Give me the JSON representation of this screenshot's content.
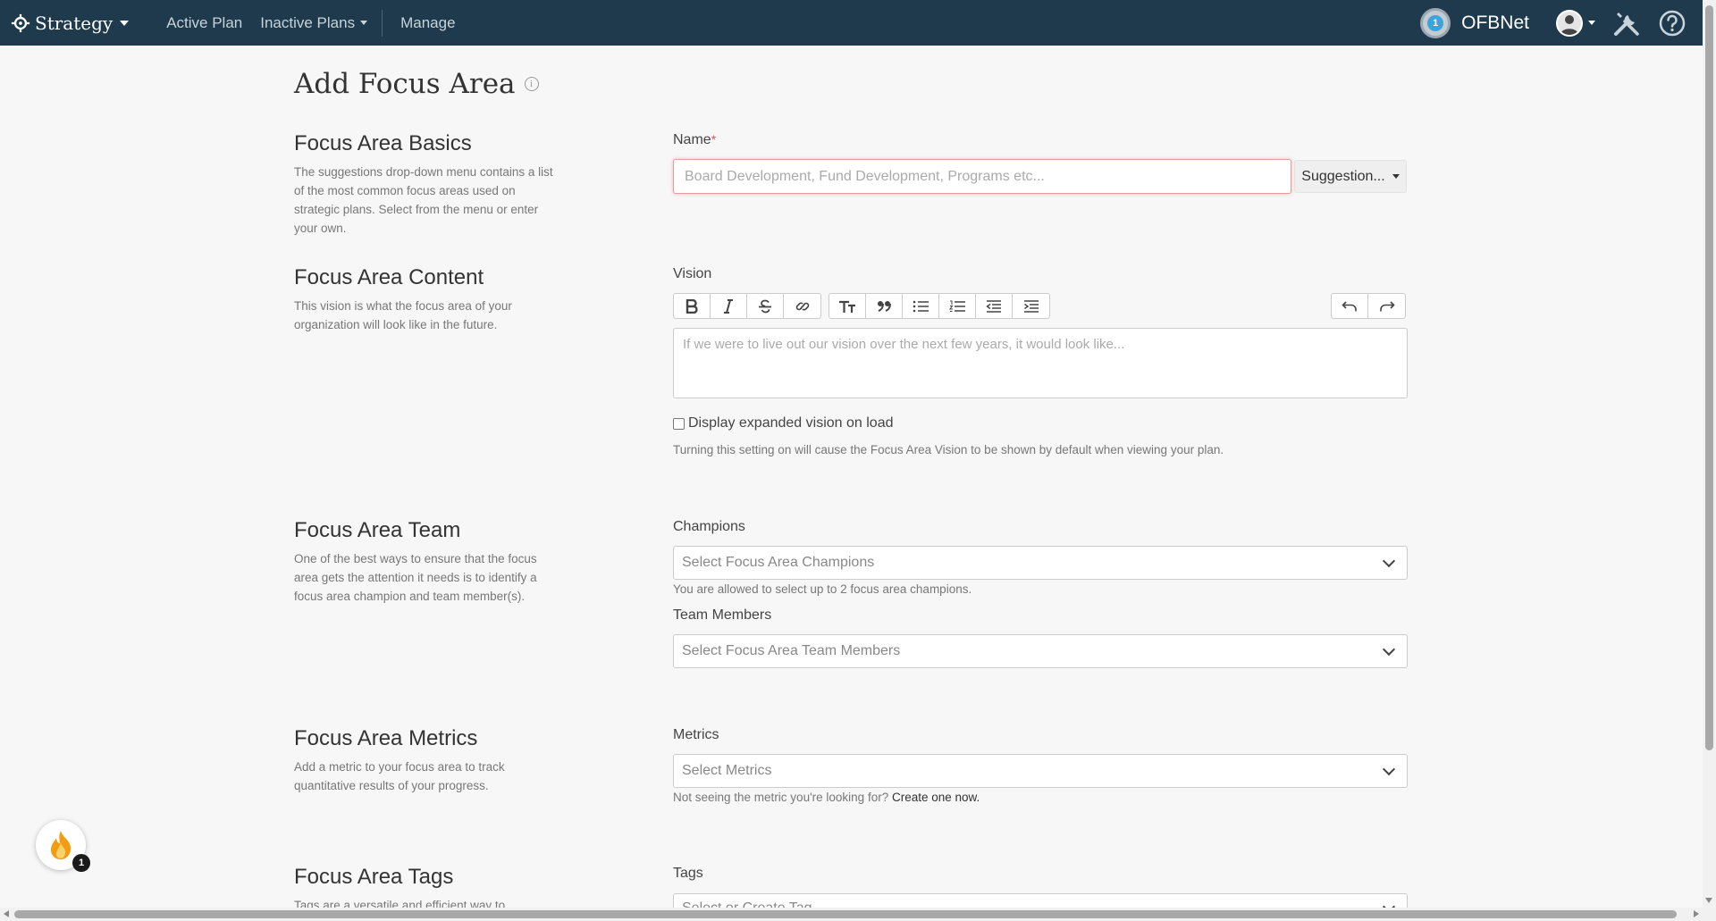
{
  "nav": {
    "brand": "Strategy",
    "links": [
      "Active Plan",
      "Inactive Plans",
      "Manage"
    ],
    "org_name": "OFBNet",
    "org_badge": "1"
  },
  "page": {
    "title": "Add Focus Area"
  },
  "sections": {
    "basics": {
      "title": "Focus Area Basics",
      "desc": "The suggestions drop-down menu contains a list of the most common focus areas used on strategic plans. Select from the menu or enter your own."
    },
    "content": {
      "title": "Focus Area Content",
      "desc": "This vision is what the focus area of your organization will look like in the future."
    },
    "team": {
      "title": "Focus Area Team",
      "desc": "One of the best ways to ensure that the focus area gets the attention it needs is to identify a focus area champion and team member(s)."
    },
    "metrics": {
      "title": "Focus Area Metrics",
      "desc": "Add a metric to your focus area to track quantitative results of your progress."
    },
    "tags": {
      "title": "Focus Area Tags",
      "desc": "Tags are a versatile and efficient way to"
    }
  },
  "form": {
    "name_label": "Name",
    "name_required": "*",
    "name_placeholder": "Board Development, Fund Development, Programs etc...",
    "name_value": "",
    "suggestion_label": "Suggestion...",
    "vision_label": "Vision",
    "vision_placeholder": "If we were to live out our vision over the next few years, it would look like...",
    "display_expanded_label": "Display expanded vision on load",
    "display_expanded_checked": false,
    "display_expanded_help": "Turning this setting on will cause the Focus Area Vision to be shown by default when viewing your plan.",
    "champions_label": "Champions",
    "champions_placeholder": "Select Focus Area Champions",
    "champions_help": "You are allowed to select up to 2 focus area champions.",
    "team_members_label": "Team Members",
    "team_members_placeholder": "Select Focus Area Team Members",
    "metrics_label": "Metrics",
    "metrics_placeholder": "Select Metrics",
    "metrics_help": "Not seeing the metric you're looking for?",
    "metrics_help_link": "Create one now.",
    "tags_label": "Tags",
    "tags_placeholder": "Select or Create Tag"
  },
  "notifications": {
    "count": "1"
  },
  "colors": {
    "nav_bg": "#1e3a4c",
    "page_bg": "#f7f7f7",
    "required": "#d9534f",
    "accent_blue": "#3aa3e0",
    "fire_orange": "#f39c12"
  }
}
